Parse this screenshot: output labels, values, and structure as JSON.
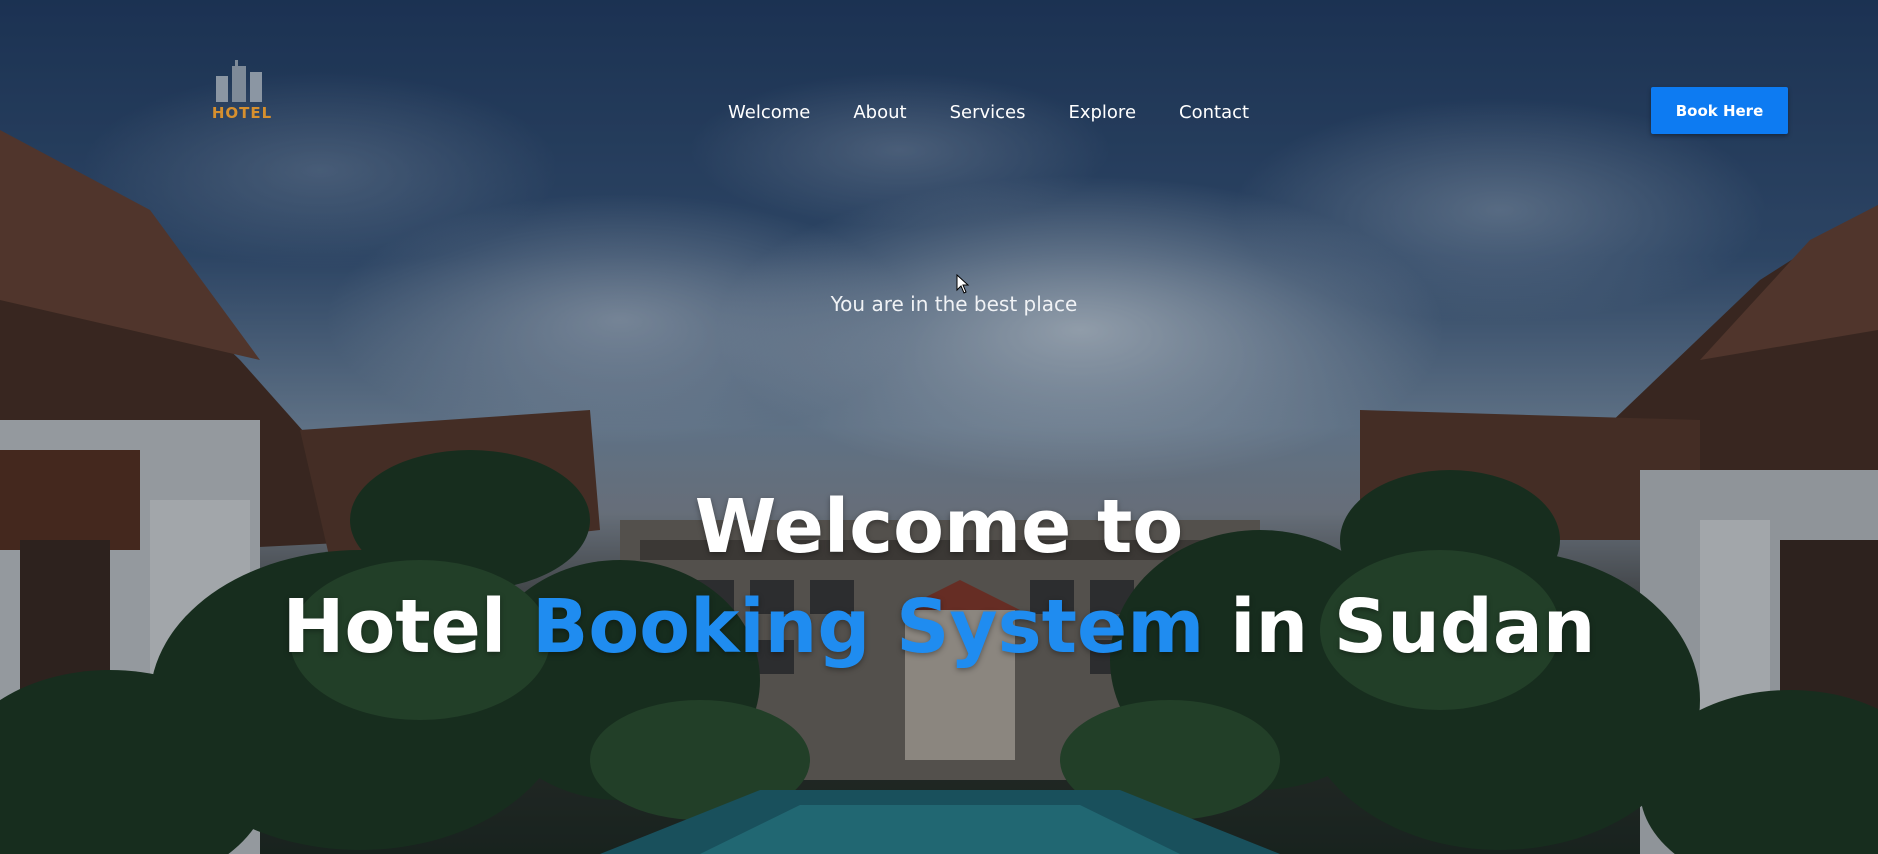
{
  "brand": {
    "logo_text": "HOTEL",
    "logo_icon": "building-icon"
  },
  "nav": {
    "items": [
      {
        "label": "Welcome"
      },
      {
        "label": "About"
      },
      {
        "label": "Services"
      },
      {
        "label": "Explore"
      },
      {
        "label": "Contact"
      }
    ]
  },
  "cta": {
    "book_label": "Book Here"
  },
  "hero": {
    "tagline": "You are in the best place",
    "headline_line1": "Welcome to",
    "headline_pre": "Hotel",
    "headline_highlight": "Booking System",
    "headline_post": "in Sudan"
  },
  "colors": {
    "accent": "#0d7bf2",
    "highlight": "#1f8cf0",
    "logo": "#d7902e",
    "text": "#ffffff"
  }
}
